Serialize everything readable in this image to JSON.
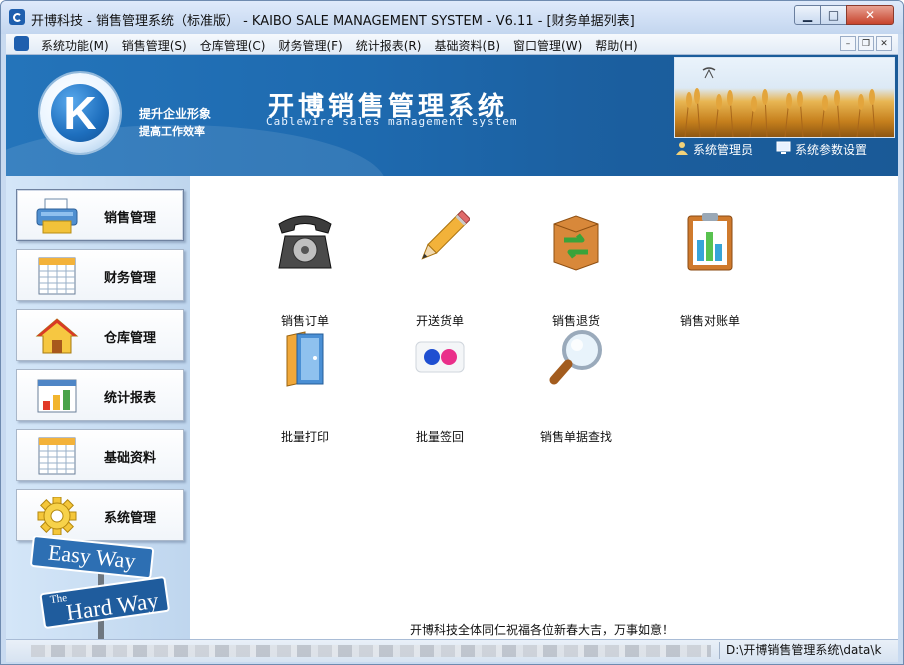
{
  "window": {
    "title": "开博科技 - 销售管理系统（标准版） - KAIBO SALE MANAGEMENT SYSTEM - V6.11 - [财务单据列表]",
    "minimize_glyph": "▁",
    "maximize_glyph": "□",
    "close_glyph": "✕"
  },
  "menubar": {
    "items": [
      {
        "label": "系统功能(M)"
      },
      {
        "label": "销售管理(S)"
      },
      {
        "label": "仓库管理(C)"
      },
      {
        "label": "财务管理(F)"
      },
      {
        "label": "统计报表(R)"
      },
      {
        "label": "基础资料(B)"
      },
      {
        "label": "窗口管理(W)"
      },
      {
        "label": "帮助(H)"
      }
    ],
    "mdi": {
      "minimize": "–",
      "restore": "❐",
      "close": "✕"
    }
  },
  "banner": {
    "logo_letter": "K",
    "slogan_line1": "提升企业形象",
    "slogan_line2": "提高工作效率",
    "title": "开博销售管理系统",
    "subtitle": "Cablewire sales management system",
    "admin_link": "系统管理员",
    "settings_link": "系统参数设置"
  },
  "sidebar": {
    "items": [
      {
        "label": "销售管理",
        "icon": "printer-icon",
        "active": true
      },
      {
        "label": "财务管理",
        "icon": "spreadsheet-icon",
        "active": false
      },
      {
        "label": "仓库管理",
        "icon": "house-icon",
        "active": false
      },
      {
        "label": "统计报表",
        "icon": "bar-chart-icon",
        "active": false
      },
      {
        "label": "基础资料",
        "icon": "table-icon",
        "active": false
      },
      {
        "label": "系统管理",
        "icon": "gear-icon",
        "active": false
      }
    ],
    "sign_top": "Easy Way",
    "sign_bottom_small": "The",
    "sign_bottom": "Hard Way"
  },
  "main": {
    "tiles": [
      {
        "label": "销售订单",
        "icon": "telephone-icon"
      },
      {
        "label": "开送货单",
        "icon": "pencil-icon"
      },
      {
        "label": "销售退货",
        "icon": "return-box-icon"
      },
      {
        "label": "销售对账单",
        "icon": "clipboard-chart-icon"
      },
      {
        "label": "批量打印",
        "icon": "folder-print-icon"
      },
      {
        "label": "批量签回",
        "icon": "dots-icon"
      },
      {
        "label": "销售单据查找",
        "icon": "magnifier-icon"
      }
    ],
    "greeting": "开博科技全体同仁祝福各位新春大吉，万事如意！"
  },
  "statusbar": {
    "path": "D:\\开博销售管理系统\\data\\k"
  },
  "colors": {
    "banner_blue": "#1e6aaf",
    "sidebar_bg": "#c8dcf2",
    "close_red": "#c7432c"
  }
}
